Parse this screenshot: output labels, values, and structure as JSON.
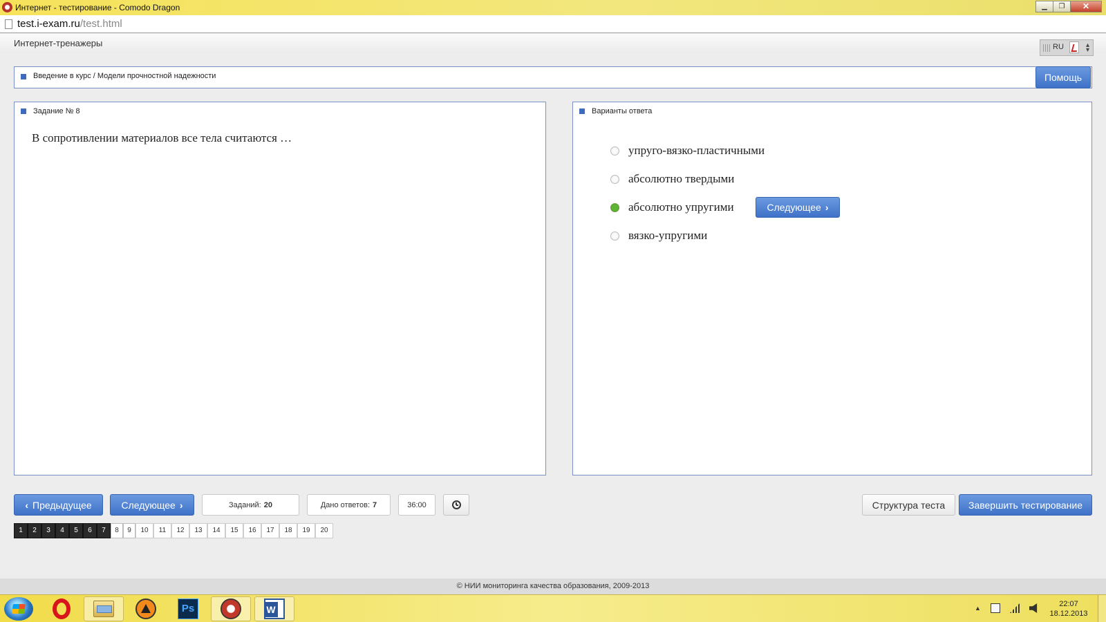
{
  "window": {
    "title": "Интернет - тестирование - Comodo Dragon",
    "minimize": "▁",
    "maximize": "❐",
    "close": "✕"
  },
  "address": {
    "host": "test.i-exam.ru",
    "path": "/test.html"
  },
  "header": {
    "brand": "Интернет-тренажеры",
    "language": "RU"
  },
  "breadcrumb": {
    "text": "Введение в курс / Модели прочностной надежности",
    "help_label": "Помощь"
  },
  "task": {
    "title": "Задание № 8",
    "question": "В сопротивлении материалов все тела считаются …"
  },
  "answers": {
    "title": "Варианты ответа",
    "options": [
      {
        "label": "упруго-вязко-пластичными",
        "selected": false
      },
      {
        "label": "абсолютно твердыми",
        "selected": false
      },
      {
        "label": "абсолютно упругими",
        "selected": true
      },
      {
        "label": "вязко-упругими",
        "selected": false
      }
    ],
    "next_label": "Следующее"
  },
  "nav": {
    "prev_label": "Предыдущее",
    "next_label": "Следующее",
    "tasks_label": "Заданий:",
    "tasks_count": "20",
    "answered_label": "Дано ответов:",
    "answered_count": "7",
    "timer": "36:00",
    "structure_label": "Структура теста",
    "finish_label": "Завершить тестирование"
  },
  "pages": {
    "items": [
      "1",
      "2",
      "3",
      "4",
      "5",
      "6",
      "7",
      "8",
      "9",
      "10",
      "11",
      "12",
      "13",
      "14",
      "15",
      "16",
      "17",
      "18",
      "19",
      "20"
    ],
    "answered": 7,
    "current": 8
  },
  "footer": {
    "copyright": "© НИИ мониторинга качества образования, 2009-2013"
  },
  "taskbar": {
    "time": "22:07",
    "date": "18.12.2013",
    "apps": [
      "opera-icon",
      "explorer-icon",
      "avast-icon",
      "photoshop-icon",
      "comodo-dragon-icon",
      "word-icon"
    ],
    "ps_text": "Ps"
  },
  "colors": {
    "accent": "#3f72c8",
    "panel_border": "#7b8fc7",
    "selected_radio": "#3e8f1f",
    "taskbar": "#f1dc4a"
  }
}
